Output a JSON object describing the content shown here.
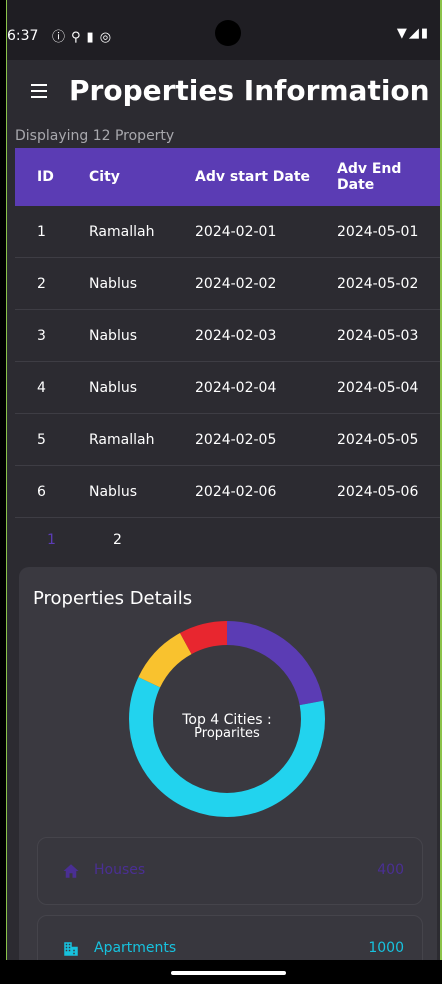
{
  "status_bar": {
    "time": "6:37",
    "left_icons": [
      "info-icon",
      "location-icon",
      "sd-card-icon",
      "notification-icon"
    ],
    "right_icons": [
      "wifi-icon",
      "signal-icon",
      "battery-icon"
    ]
  },
  "app_bar": {
    "title": "Properties Information"
  },
  "subtitle": "Displaying 12 Property",
  "table": {
    "headers": [
      "ID",
      "City",
      "Adv start Date",
      "Adv End Date"
    ],
    "rows": [
      [
        "1",
        "Ramallah",
        "2024-02-01",
        "2024-05-01"
      ],
      [
        "2",
        "Nablus",
        "2024-02-02",
        "2024-05-02"
      ],
      [
        "3",
        "Nablus",
        "2024-02-03",
        "2024-05-03"
      ],
      [
        "4",
        "Nablus",
        "2024-02-04",
        "2024-05-04"
      ],
      [
        "5",
        "Ramallah",
        "2024-02-05",
        "2024-05-05"
      ],
      [
        "6",
        "Nablus",
        "2024-02-06",
        "2024-05-06"
      ]
    ]
  },
  "pagination": {
    "pages": [
      "1",
      "2"
    ],
    "active_page": "1"
  },
  "details": {
    "title": "Properties Details",
    "donut_center_line1": "Top 4 Cities :",
    "donut_center_line2": "Proparites",
    "donut_segments": [
      {
        "value": 22,
        "color": "#5b3cb4"
      },
      {
        "value": 60,
        "color": "#22d3ee"
      },
      {
        "value": 10,
        "color": "#f9c22e"
      },
      {
        "value": 8,
        "color": "#e8262f"
      }
    ],
    "stats": [
      {
        "label": "Houses",
        "value": "400",
        "icon": "home-icon"
      },
      {
        "label": "Apartments",
        "value": "1000",
        "icon": "apartment-icon"
      }
    ]
  },
  "colors": {
    "accent": "#5b3cb4",
    "background": "#2c2b31",
    "card": "#3a3940",
    "cyan": "#22d3ee",
    "yellow": "#f9c22e",
    "red": "#e8262f"
  }
}
